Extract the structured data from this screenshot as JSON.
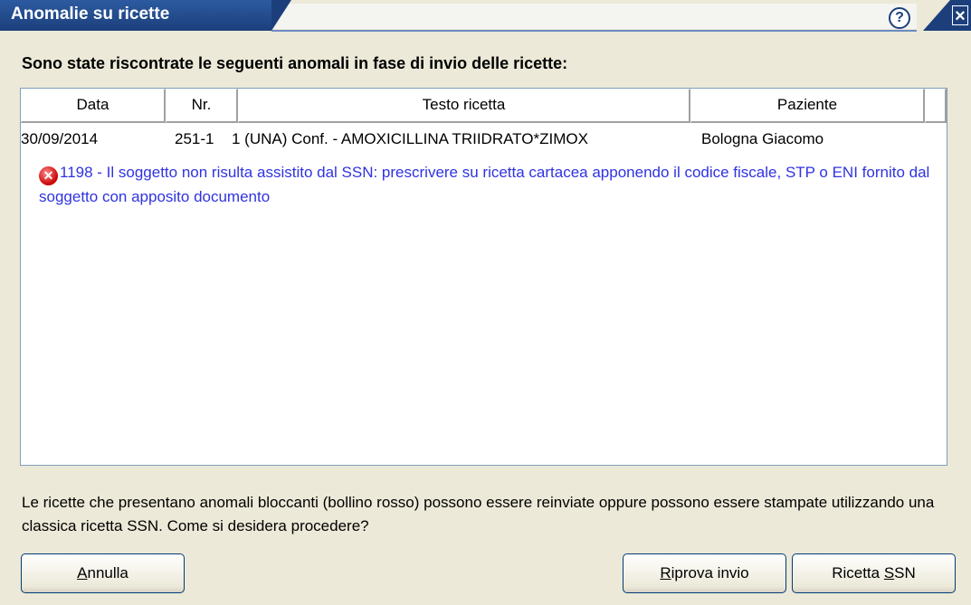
{
  "window": {
    "title": "Anomalie su ricette",
    "help_glyph": "?",
    "close_glyph": "×"
  },
  "heading": "Sono state riscontrate le seguenti anomali in fase di invio delle ricette:",
  "table": {
    "columns": [
      "Data",
      "Nr.",
      "Testo ricetta",
      "Paziente"
    ],
    "rows": [
      {
        "data": "30/09/2014",
        "nr": "251-1",
        "testo": "1 (UNA) Conf. - AMOXICILLINA TRIIDRATO*ZIMOX",
        "paziente": "Bologna Giacomo"
      }
    ],
    "error": {
      "icon": "error-icon",
      "glyph": "✕",
      "message": "1198 - Il soggetto non risulta assistito dal SSN: prescrivere su ricetta cartacea apponendo il codice fiscale, STP o ENI fornito dal soggetto con apposito documento",
      "color": "#2f33e0"
    }
  },
  "footer_text": "Le ricette che presentano anomali bloccanti (bollino rosso) possono essere reinviate oppure possono essere stampate utilizzando una classica ricetta SSN. Come si desidera procedere?",
  "buttons": {
    "annulla": {
      "first": "A",
      "rest": "nnulla"
    },
    "riprova": {
      "first": "R",
      "rest": "iprova invio"
    },
    "ricetta": {
      "prefix": "Ricetta ",
      "first": "S",
      "rest": "SN"
    }
  },
  "colors": {
    "titlebar": "#1c3f7c",
    "background": "#ece9d8",
    "error_text": "#2f33e0"
  }
}
